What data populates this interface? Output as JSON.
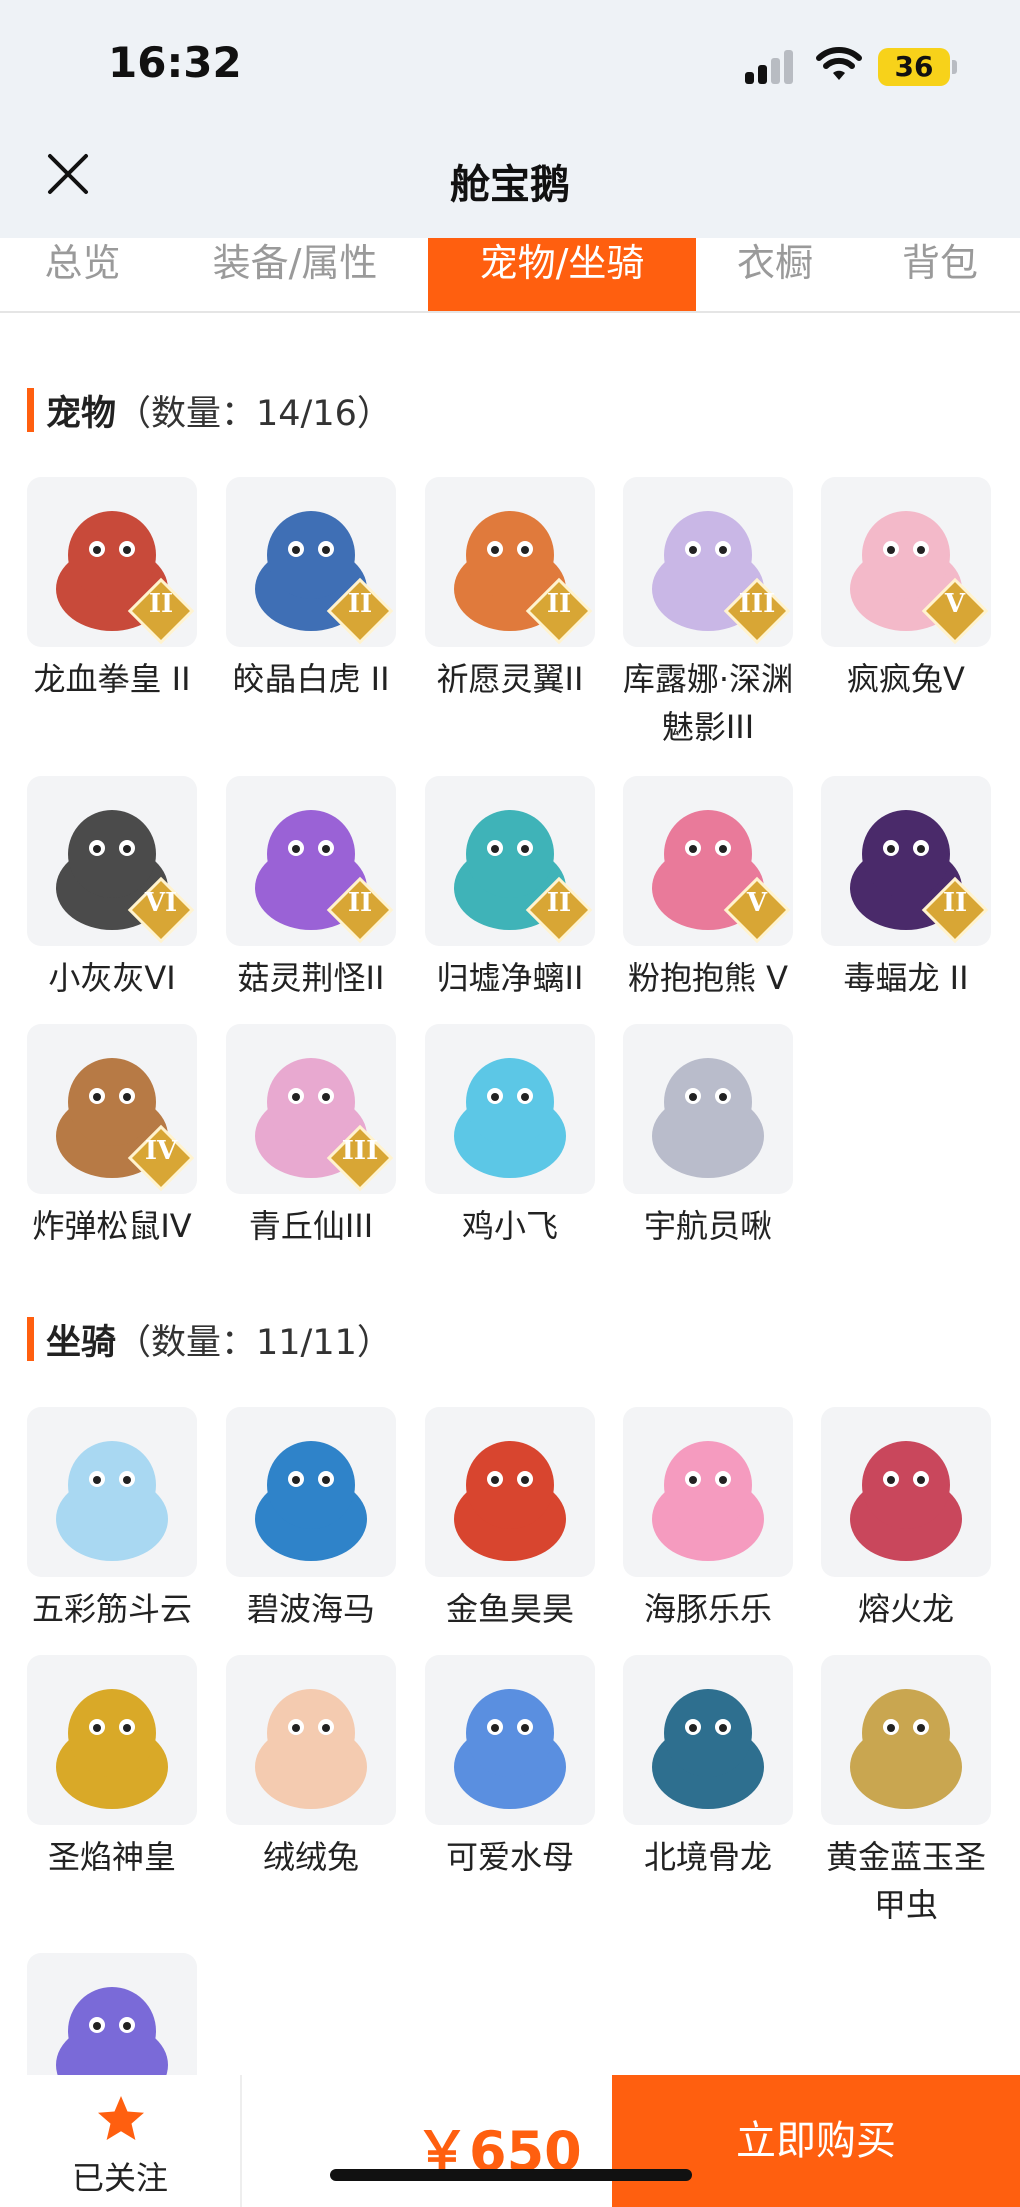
{
  "status_bar": {
    "time": "16:32",
    "battery": "36"
  },
  "nav": {
    "title": "舱宝鹅"
  },
  "tabs": [
    {
      "label": "总览",
      "active": false
    },
    {
      "label": "装备/属性",
      "active": false
    },
    {
      "label": "宠物/坐骑",
      "active": true
    },
    {
      "label": "衣橱",
      "active": false
    },
    {
      "label": "背包",
      "active": false
    }
  ],
  "pets": {
    "title": "宠物",
    "count": "（数量：14/16）",
    "items": [
      {
        "name": "龙血拳皇 II",
        "icon": "red-dragon-pet",
        "color": "#c84a3a",
        "rank": "II"
      },
      {
        "name": "皎晶白虎 II",
        "icon": "white-tiger-pet",
        "color": "#3f6fb5",
        "rank": "II"
      },
      {
        "name": "祈愿灵翼II",
        "icon": "griffin-pet",
        "color": "#e07a3c",
        "rank": "II"
      },
      {
        "name": "库露娜·深渊魅影III",
        "icon": "fairy-girl-pet",
        "color": "#c9b7e6",
        "rank": "III"
      },
      {
        "name": "疯疯兔V",
        "icon": "pink-rabbit-pet",
        "color": "#f3b9c9",
        "rank": "V"
      },
      {
        "name": "小灰灰VI",
        "icon": "grey-wolf-pet",
        "color": "#4b4b4b",
        "rank": "VI"
      },
      {
        "name": "菇灵荆怪II",
        "icon": "mushroom-elf-pet",
        "color": "#9a62d6",
        "rank": "II"
      },
      {
        "name": "归墟净螭II",
        "icon": "sea-dragon-pet",
        "color": "#3fb3b8",
        "rank": "II"
      },
      {
        "name": "粉抱抱熊 V",
        "icon": "pink-bear-pet",
        "color": "#e97a9a",
        "rank": "V"
      },
      {
        "name": "毒蝠龙 II",
        "icon": "bat-dragon-pet",
        "color": "#4a2a6a",
        "rank": "II"
      },
      {
        "name": "炸弹松鼠IV",
        "icon": "squirrel-pet",
        "color": "#b77a45",
        "rank": "IV"
      },
      {
        "name": "青丘仙III",
        "icon": "fox-fairy-pet",
        "color": "#e8a9d0",
        "rank": "III"
      },
      {
        "name": "鸡小飞",
        "icon": "blue-chick-pet",
        "color": "#5cc7e6",
        "rank": ""
      },
      {
        "name": "宇航员啾",
        "icon": "astronaut-pet",
        "color": "#b9bccb",
        "rank": ""
      }
    ]
  },
  "mounts": {
    "title": "坐骑",
    "count": "（数量：11/11）",
    "items": [
      {
        "name": "五彩筋斗云",
        "icon": "cloud-mount",
        "color": "#a9d8f2"
      },
      {
        "name": "碧波海马",
        "icon": "seahorse-mount",
        "color": "#2f83c9"
      },
      {
        "name": "金鱼昊昊",
        "icon": "goldfish-mount",
        "color": "#d8452f"
      },
      {
        "name": "海豚乐乐",
        "icon": "dolphin-mount",
        "color": "#f59bbf"
      },
      {
        "name": "熔火龙",
        "icon": "lava-dragon-mount",
        "color": "#c9475c"
      },
      {
        "name": "圣焰神皇",
        "icon": "golden-phoenix-mount",
        "color": "#d9a928"
      },
      {
        "name": "绒绒兔",
        "icon": "fluffy-rabbit-mount",
        "color": "#f4cbb0"
      },
      {
        "name": "可爱水母",
        "icon": "jellyfish-mount",
        "color": "#5a8fe0"
      },
      {
        "name": "北境骨龙",
        "icon": "bone-dragon-mount",
        "color": "#2e6f8f"
      },
      {
        "name": "黄金蓝玉圣甲虫",
        "icon": "scarab-mount",
        "color": "#c9a650"
      },
      {
        "name": "",
        "icon": "owl-mount",
        "color": "#7a6ad8"
      }
    ]
  },
  "bottom_bar": {
    "follow_label": "已关注",
    "price": "￥650",
    "buy_label": "立即购买"
  },
  "colors": {
    "accent": "#ff5f0f",
    "header_bg": "#eef2f6"
  }
}
